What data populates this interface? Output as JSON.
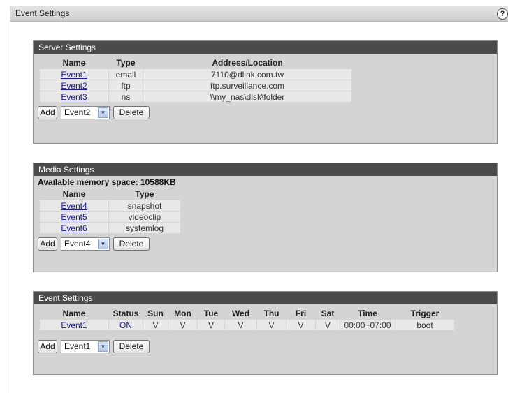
{
  "page": {
    "title": "Event Settings",
    "help": "?"
  },
  "server": {
    "title": "Server Settings",
    "headers": [
      "Name",
      "Type",
      "Address/Location"
    ],
    "rows": [
      {
        "name": "Event1",
        "type": "email",
        "address": "7110@dlink.com.tw"
      },
      {
        "name": "Event2",
        "type": "ftp",
        "address": "ftp.surveillance.com"
      },
      {
        "name": "Event3",
        "type": "ns",
        "address": "\\\\my_nas\\disk\\folder"
      }
    ],
    "add_label": "Add",
    "select_value": "Event2",
    "delete_label": "Delete"
  },
  "media": {
    "title": "Media Settings",
    "memory": "Available memory space: 10588KB",
    "headers": [
      "Name",
      "Type"
    ],
    "rows": [
      {
        "name": "Event4",
        "type": "snapshot"
      },
      {
        "name": "Event5",
        "type": "videoclip"
      },
      {
        "name": "Event6",
        "type": "systemlog"
      }
    ],
    "add_label": "Add",
    "select_value": "Event4",
    "delete_label": "Delete"
  },
  "events": {
    "title": "Event Settings",
    "headers": [
      "Name",
      "Status",
      "Sun",
      "Mon",
      "Tue",
      "Wed",
      "Thu",
      "Fri",
      "Sat",
      "Time",
      "Trigger"
    ],
    "rows": [
      {
        "name": "Event1",
        "status": "ON",
        "sun": "V",
        "mon": "V",
        "tue": "V",
        "wed": "V",
        "thu": "V",
        "fri": "V",
        "sat": "V",
        "time": "00:00~07:00",
        "trigger": "boot"
      }
    ],
    "add_label": "Add",
    "select_value": "Event1",
    "delete_label": "Delete"
  },
  "icons": {
    "select_arrow": "chevron-down-icon",
    "help": "help-icon"
  }
}
